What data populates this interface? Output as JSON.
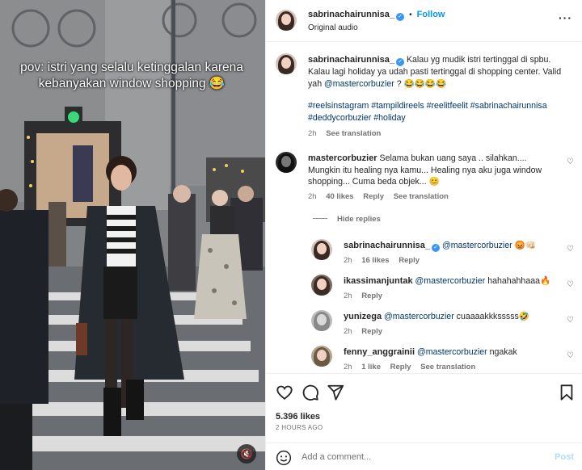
{
  "media": {
    "caption_overlay": "pov: istri yang selalu ketinggalan karena kebanyakan window shopping 😂",
    "mute_icon": "speaker-muted-icon"
  },
  "header": {
    "username": "sabrinachairunnisa_",
    "follow_label": "Follow",
    "separator": "•",
    "audio": "Original audio"
  },
  "caption": {
    "username": "sabrinachairunnisa_",
    "text": "Kalau yg mudik istri tertinggal di spbu. Kalau lagi holiday ya udah pasti tertinggal di shopping center. Valid yah",
    "mention": "@mastercorbuzier",
    "text_end": " ? 😂😂😂😂",
    "hashtags": "#reelsinstagram #tampildireels #reelitfeelit #sabrinachairunnisa #deddycorbuzier #holiday",
    "time": "2h",
    "see_translation": "See translation"
  },
  "comments": [
    {
      "username": "mastercorbuzier",
      "text": "Selama bukan uang saya .. silahkan.... Mungkin itu healing nya kamu... Healing nya aku juga window shopping... Cuma beda objek... 😊",
      "time": "2h",
      "likes": "40 likes",
      "reply": "Reply",
      "see_translation": "See translation"
    }
  ],
  "hide_replies": "Hide replies",
  "replies": [
    {
      "username": "sabrinachairunnisa_",
      "mention": "@mastercorbuzier",
      "text": " 😡👊🏻",
      "time": "2h",
      "likes": "16 likes",
      "reply": "Reply"
    },
    {
      "username": "ikassimanjuntak",
      "mention": "@mastercorbuzier",
      "text": " hahahahhaaa🔥",
      "time": "2h",
      "reply": "Reply"
    },
    {
      "username": "yunizega",
      "mention": "@mastercorbuzier",
      "text": " cuaaaakkksssss🤣",
      "time": "2h",
      "reply": "Reply"
    },
    {
      "username": "fenny_anggrainii",
      "mention": "@mastercorbuzier",
      "text": " ngakak",
      "time": "2h",
      "likes": "1 like",
      "reply": "Reply",
      "see_translation": "See translation"
    }
  ],
  "stats": {
    "likes": "5.396 likes",
    "ago": "2 HOURS AGO"
  },
  "composer": {
    "placeholder": "Add a comment...",
    "post_label": "Post"
  },
  "colors": {
    "accent": "#0095f6",
    "mention": "#00376b",
    "muted": "#737373"
  }
}
